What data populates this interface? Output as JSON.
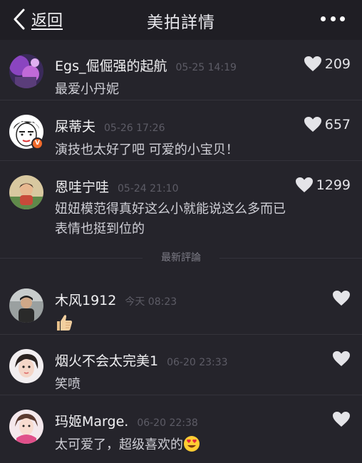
{
  "nav": {
    "back_label": "返回",
    "title": "美拍詳情",
    "more_icon": "more-dots-icon"
  },
  "hot_comments": [
    {
      "name": "Egs_倔倔强的起航",
      "time": "05-25 14:19",
      "text": "最爱小丹妮",
      "likes": "209"
    },
    {
      "name": "屎蒂夫",
      "time": "05-26 17:26",
      "text": "演技也太好了吧 可爱的小宝贝！",
      "likes": "657",
      "verified": true
    },
    {
      "name": "恩哇宁哇",
      "time": "05-24 21:10",
      "text": "妞妞模范得真好这么小就能说这么多而已表情也挺到位的",
      "likes": "1299"
    }
  ],
  "section_label": "最新評論",
  "latest_comments": [
    {
      "name": "木风1912",
      "time": "今天 08:23",
      "text": "",
      "emoji": "thumbs-up"
    },
    {
      "name": "烟火不会太完美1",
      "time": "06-20 23:33",
      "text": "笑喷"
    },
    {
      "name": "玛姬Marge.",
      "time": "06-20 22:38",
      "text": "太可爱了，超级喜欢的",
      "emoji": "heart-eyes"
    }
  ],
  "colors": {
    "background": "#25242b",
    "navbar": "#1f1e24",
    "time_text": "#5d5c66",
    "verified_badge": "#f06a2b"
  }
}
